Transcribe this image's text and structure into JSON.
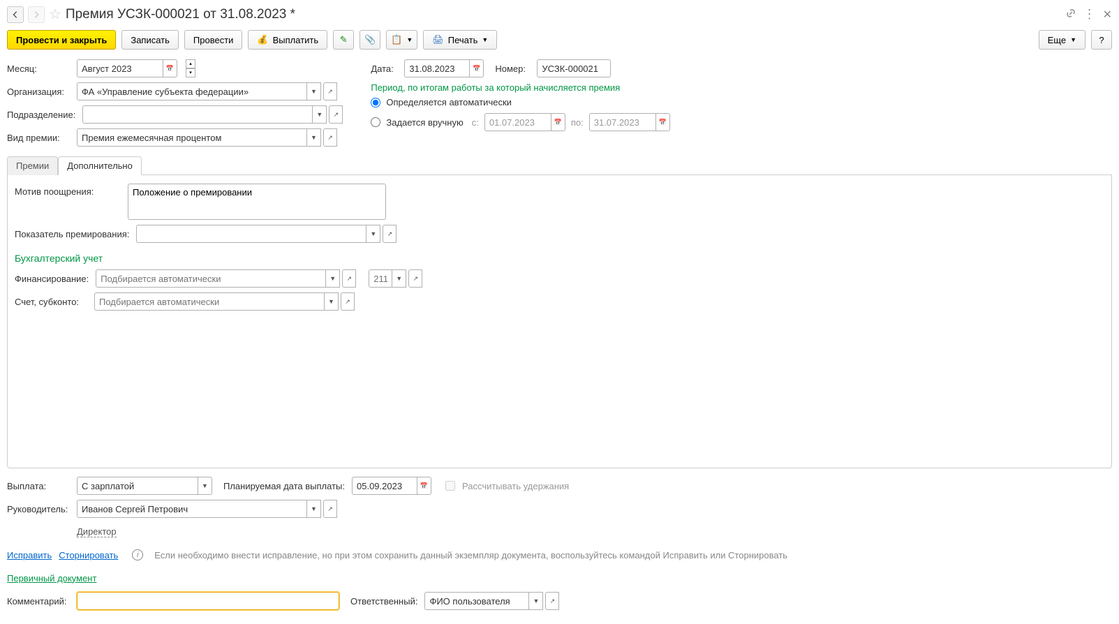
{
  "header": {
    "title": "Премия УСЗК-000021 от 31.08.2023 *"
  },
  "toolbar": {
    "post_close": "Провести и закрыть",
    "save": "Записать",
    "post": "Провести",
    "payout": "Выплатить",
    "print": "Печать",
    "more": "Еще",
    "help": "?"
  },
  "fields": {
    "month_lbl": "Месяц:",
    "month_val": "Август 2023",
    "date_lbl": "Дата:",
    "date_val": "31.08.2023",
    "number_lbl": "Номер:",
    "number_val": "УСЗК-000021",
    "org_lbl": "Организация:",
    "org_val": "ФА «Управление субъекта федерации»",
    "dept_lbl": "Подразделение:",
    "dept_val": "",
    "bonus_type_lbl": "Вид премии:",
    "bonus_type_val": "Премия ежемесячная процентом"
  },
  "period": {
    "heading": "Период, по итогам работы за который начисляется премия",
    "auto": "Определяется автоматически",
    "manual": "Задается вручную",
    "from_lbl": "с:",
    "from_val": "01.07.2023",
    "to_lbl": "по:",
    "to_val": "31.07.2023"
  },
  "tabs": {
    "t1": "Премии",
    "t2": "Дополнительно"
  },
  "extra": {
    "motive_lbl": "Мотив поощрения:",
    "motive_val": "Положение о премировании",
    "indicator_lbl": "Показатель премирования:",
    "indicator_val": "",
    "acct_heading": "Бухгалтерский учет",
    "fin_lbl": "Финансирование:",
    "fin_ph": "Подбирается автоматически",
    "code_ph": "211",
    "account_lbl": "Счет, субконто:",
    "account_ph": "Подбирается автоматически"
  },
  "footer": {
    "payment_lbl": "Выплата:",
    "payment_val": "С зарплатой",
    "planned_date_lbl": "Планируемая дата выплаты:",
    "planned_date_val": "05.09.2023",
    "calc_cb": "Рассчитывать удержания",
    "head_lbl": "Руководитель:",
    "head_val": "Иванов Сергей Петрович",
    "head_pos": "Директор",
    "fix": "Исправить",
    "storno": "Сторнировать",
    "hint": "Если необходимо внести исправление, но при этом сохранить данный экземпляр документа, воспользуйтесь командой Исправить или Сторнировать",
    "primary_doc": "Первичный документ",
    "comment_lbl": "Комментарий:",
    "comment_val": "",
    "resp_lbl": "Ответственный:",
    "resp_val": "ФИО пользователя"
  }
}
